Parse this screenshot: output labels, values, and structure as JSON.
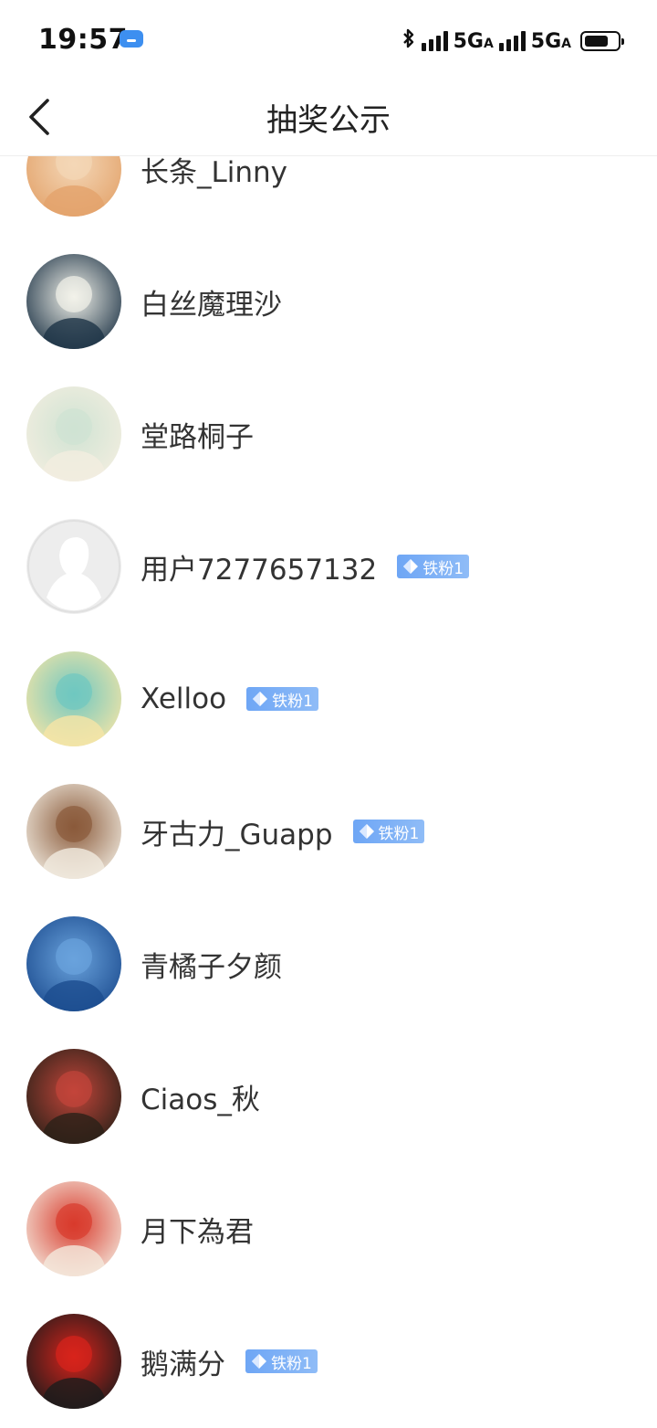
{
  "status": {
    "time": "19:57",
    "network1": "5G",
    "network1_sub": "A",
    "network2": "5G",
    "network2_sub": "A",
    "battery_level": 0.7
  },
  "nav": {
    "title": "抽奖公示",
    "back_icon": "chevron-left-icon"
  },
  "winners": [
    {
      "name": "长条_Linny",
      "badge": null,
      "avatar_colors": [
        "#e3a36b",
        "#f4d7b7"
      ]
    },
    {
      "name": "白丝魔理沙",
      "badge": null,
      "avatar_colors": [
        "#1d3346",
        "#f2f2ea"
      ]
    },
    {
      "name": "堂路桐子",
      "badge": null,
      "avatar_colors": [
        "#f3eee0",
        "#cfe3d3"
      ]
    },
    {
      "name": "用户7277657132",
      "badge": "铁粉1",
      "avatar_colors": [
        "#eeeeee",
        "#ffffff"
      ]
    },
    {
      "name": "Xelloo",
      "badge": "铁粉1",
      "avatar_colors": [
        "#f6e5a6",
        "#6fc7c1"
      ]
    },
    {
      "name": "牙古力_Guapp",
      "badge": "铁粉1",
      "avatar_colors": [
        "#f1ebe0",
        "#8a5a3a"
      ]
    },
    {
      "name": "青橘子夕颜",
      "badge": null,
      "avatar_colors": [
        "#1c4c8f",
        "#6aa3dd"
      ]
    },
    {
      "name": "Ciaos_秋",
      "badge": null,
      "avatar_colors": [
        "#2a2118",
        "#c3453a"
      ]
    },
    {
      "name": "月下為君",
      "badge": null,
      "avatar_colors": [
        "#f4e8dc",
        "#d83a2c"
      ]
    },
    {
      "name": "鹅满分",
      "badge": "铁粉1",
      "avatar_colors": [
        "#1b1b1b",
        "#d8231b"
      ]
    }
  ]
}
